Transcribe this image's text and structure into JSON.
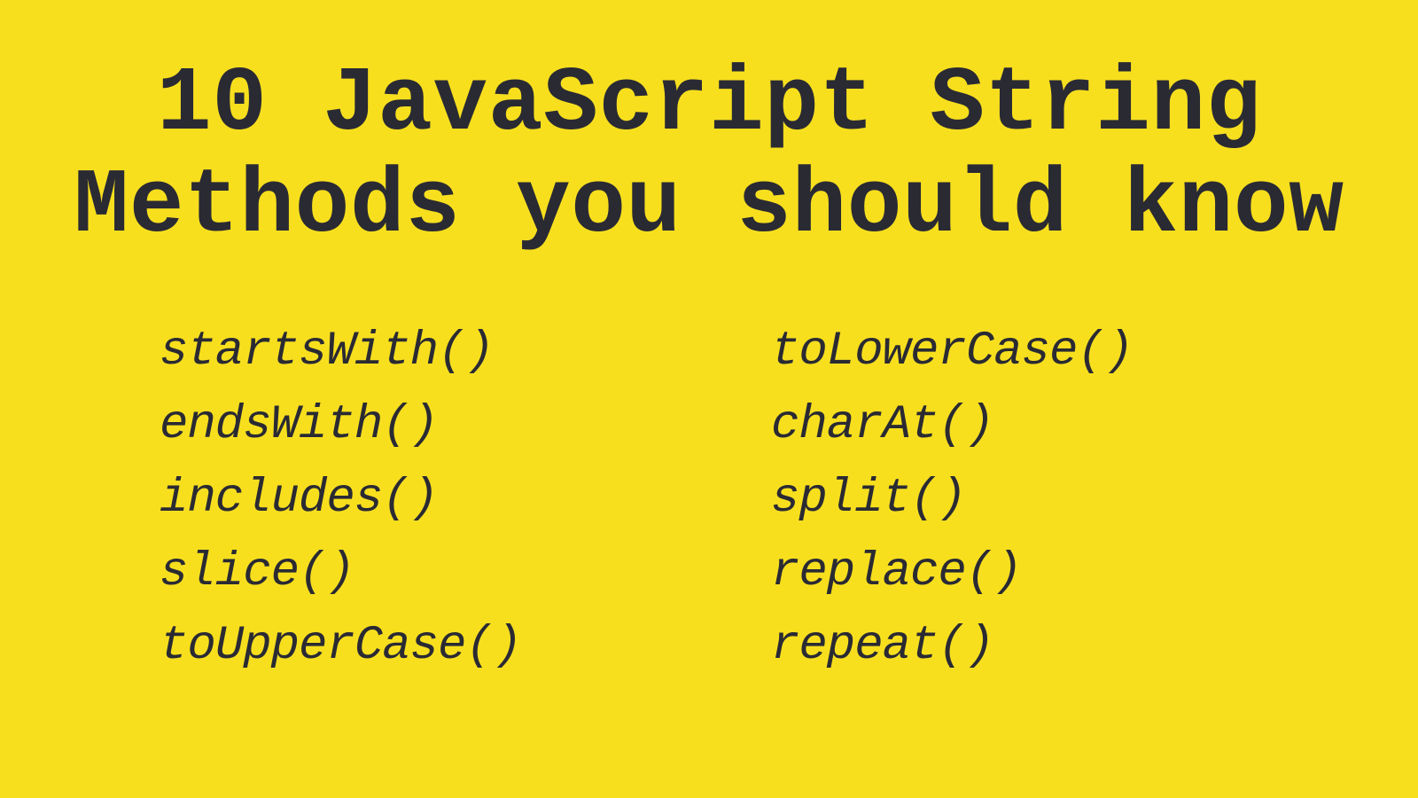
{
  "title_line1": "10 JavaScript String",
  "title_line2": "Methods you should know",
  "columns": {
    "left": [
      "startsWith()",
      "endsWith()",
      "includes()",
      "slice()",
      "toUpperCase()"
    ],
    "right": [
      "toLowerCase()",
      "charAt()",
      "split()",
      "replace()",
      "repeat()"
    ]
  },
  "colors": {
    "background": "#f7df1e",
    "text": "#2a2a33"
  }
}
